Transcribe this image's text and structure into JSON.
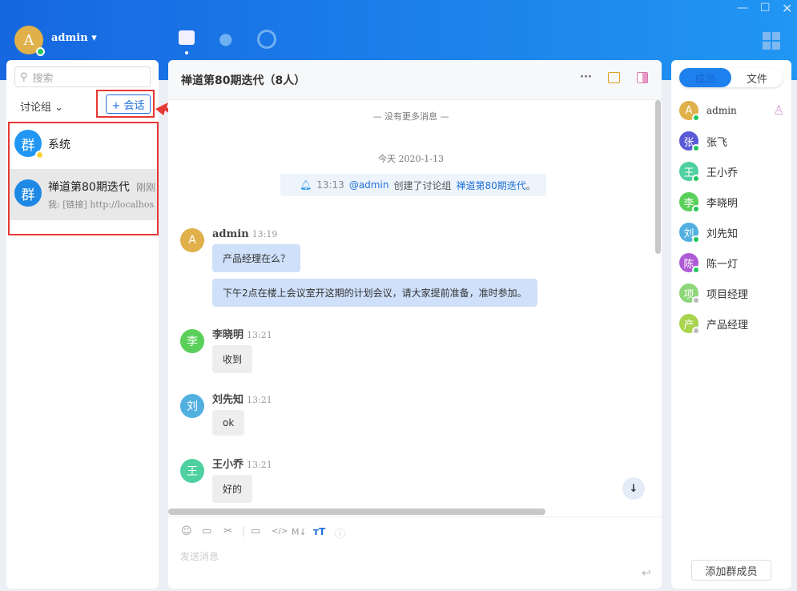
{
  "header": {
    "user_initial": "A",
    "username": "admin"
  },
  "sidebar": {
    "search_placeholder": "搜索",
    "filter_label": "讨论组",
    "new_chat_label": "+ 会话",
    "chats": [
      {
        "icon": "群",
        "name": "系统",
        "time": "",
        "preview": ""
      },
      {
        "icon": "群",
        "name": "禅道第80期迭代",
        "time": "刚刚",
        "preview": "我: [链接] http://localhos…"
      }
    ]
  },
  "chat": {
    "title": "禅道第80期迭代（8人）",
    "no_more": "— 没有更多消息 —",
    "date": "今天 2020-1-13",
    "notice": {
      "time": "13:13",
      "mention": "@admin",
      "text": "创建了讨论组",
      "group": "禅道第80期迭代",
      "end": "。"
    },
    "messages": [
      {
        "initial": "A",
        "name": "admin",
        "time": "13:19",
        "color": "#e0b04a",
        "bubbles": [
          "产品经理在么？",
          "下午2点在楼上会议室开这期的计划会议，请大家提前准备，准时参加。"
        ]
      },
      {
        "initial": "李",
        "name": "李晓明",
        "time": "13:21",
        "color": "#5ad05a",
        "bubbles": [
          "收到"
        ]
      },
      {
        "initial": "刘",
        "name": "刘先知",
        "time": "13:21",
        "color": "#52b0e0",
        "bubbles": [
          "ok"
        ]
      },
      {
        "initial": "王",
        "name": "王小乔",
        "time": "13:21",
        "color": "#4fd0a0",
        "bubbles": [
          "好的"
        ]
      }
    ],
    "input_placeholder": "发送消息"
  },
  "members": {
    "tabs": [
      "成员",
      "文件"
    ],
    "list": [
      {
        "initial": "A",
        "name": "admin",
        "color": "#e0b04a",
        "online": true
      },
      {
        "initial": "张",
        "name": "张飞",
        "color": "#5a5ad6",
        "online": true
      },
      {
        "initial": "王",
        "name": "王小乔",
        "color": "#4fd0a0",
        "online": true
      },
      {
        "initial": "李",
        "name": "李晓明",
        "color": "#5ad05a",
        "online": true
      },
      {
        "initial": "刘",
        "name": "刘先知",
        "color": "#52b0e0",
        "online": true
      },
      {
        "initial": "陈",
        "name": "陈一灯",
        "color": "#b05ad6",
        "online": true
      },
      {
        "initial": "项",
        "name": "项目经理",
        "color": "#8ed67a",
        "online": false
      },
      {
        "initial": "产",
        "name": "产品经理",
        "color": "#a8d44e",
        "online": false
      }
    ],
    "add_label": "添加群成员"
  }
}
